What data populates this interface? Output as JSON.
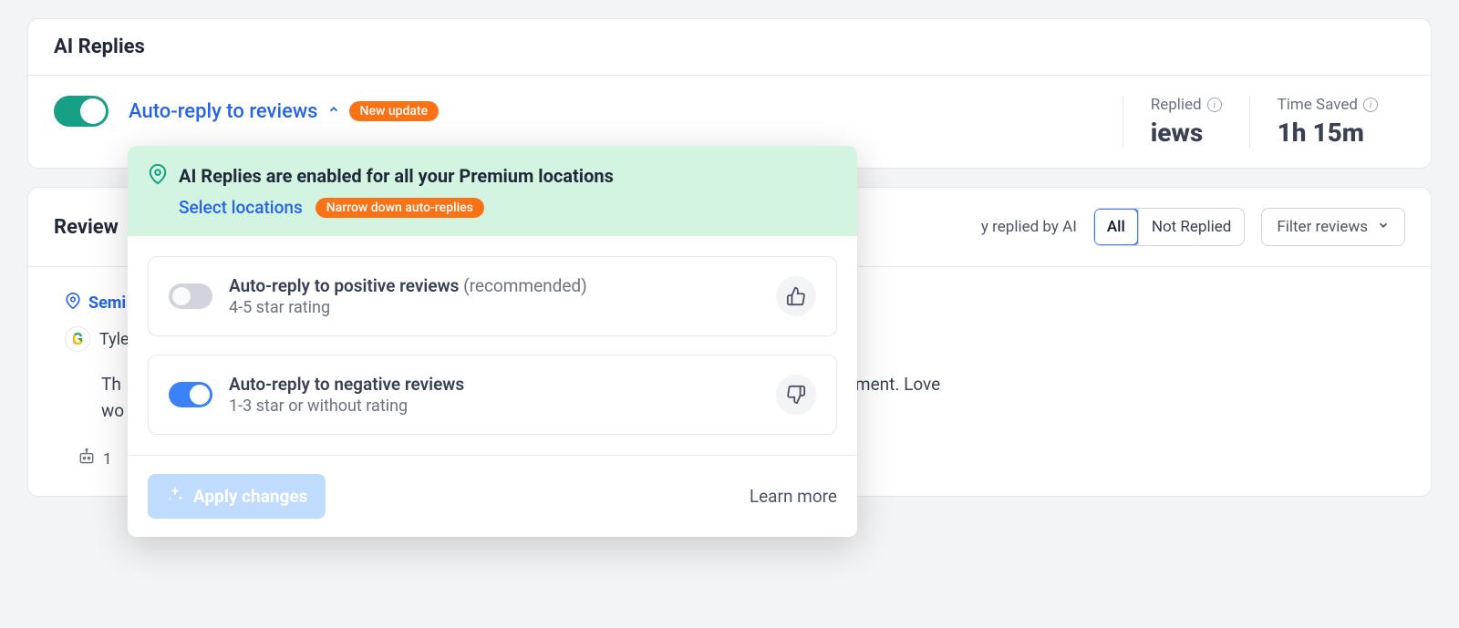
{
  "ai_replies": {
    "title": "AI Replies",
    "toggle_on": true,
    "auto_reply_label": "Auto-reply to reviews",
    "new_update_badge": "New update",
    "stats": {
      "replied_label": "Replied",
      "replied_value_partial": "iews",
      "time_saved_label": "Time Saved",
      "time_saved_value": "1h 15m"
    }
  },
  "popover": {
    "banner_text": "AI Replies are enabled for all your Premium locations",
    "select_locations": "Select locations",
    "narrow_badge": "Narrow down auto-replies",
    "options": [
      {
        "title": "Auto-reply to positive reviews",
        "hint": "(recommended)",
        "sub": "4-5 star rating",
        "on": false
      },
      {
        "title": "Auto-reply to negative reviews",
        "hint": "",
        "sub": "1-3 star or without rating",
        "on": true
      }
    ],
    "apply_label": "Apply changes",
    "learn_more": "Learn more"
  },
  "reviews": {
    "title_partial": "Review",
    "filter_label_partial": "y replied by AI",
    "seg": [
      "All",
      "Not Replied"
    ],
    "filter_btn": "Filter reviews",
    "location_partial": "Semi",
    "user_partial": "Tyle",
    "text_start": "Th",
    "text_end": "y environment. Love",
    "text_line2": "wo",
    "meta_count": "1"
  }
}
